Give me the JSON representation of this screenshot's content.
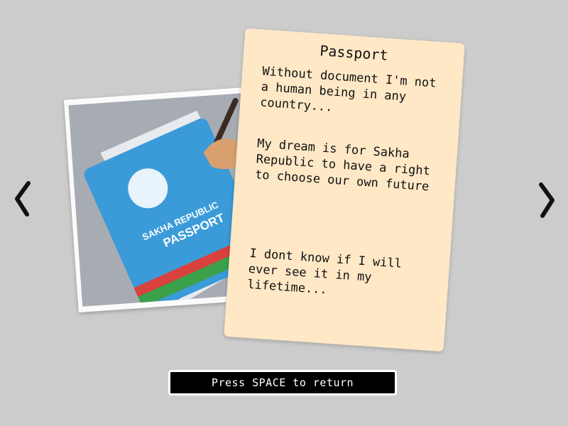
{
  "navigation": {
    "prev_icon": "chevron-left-icon",
    "next_icon": "chevron-right-icon"
  },
  "photo": {
    "passport_line1": "SAKHA REPUBLIC",
    "passport_line2": "PASSPORT",
    "colors": {
      "passport_cover": "#3a9bd8",
      "stripe_red": "#d8413c",
      "stripe_green": "#3aa04a",
      "background": "#a7acb3"
    }
  },
  "note": {
    "title": "Passport",
    "paragraphs": [
      "Without document I'm not a human being in any country...",
      "My dream is for Sakha Republic to have a right to choose our own future",
      "I dont know if I will ever see it in my lifetime..."
    ],
    "background": "#ffe8c6"
  },
  "prompt": {
    "text": "Press SPACE to return"
  }
}
